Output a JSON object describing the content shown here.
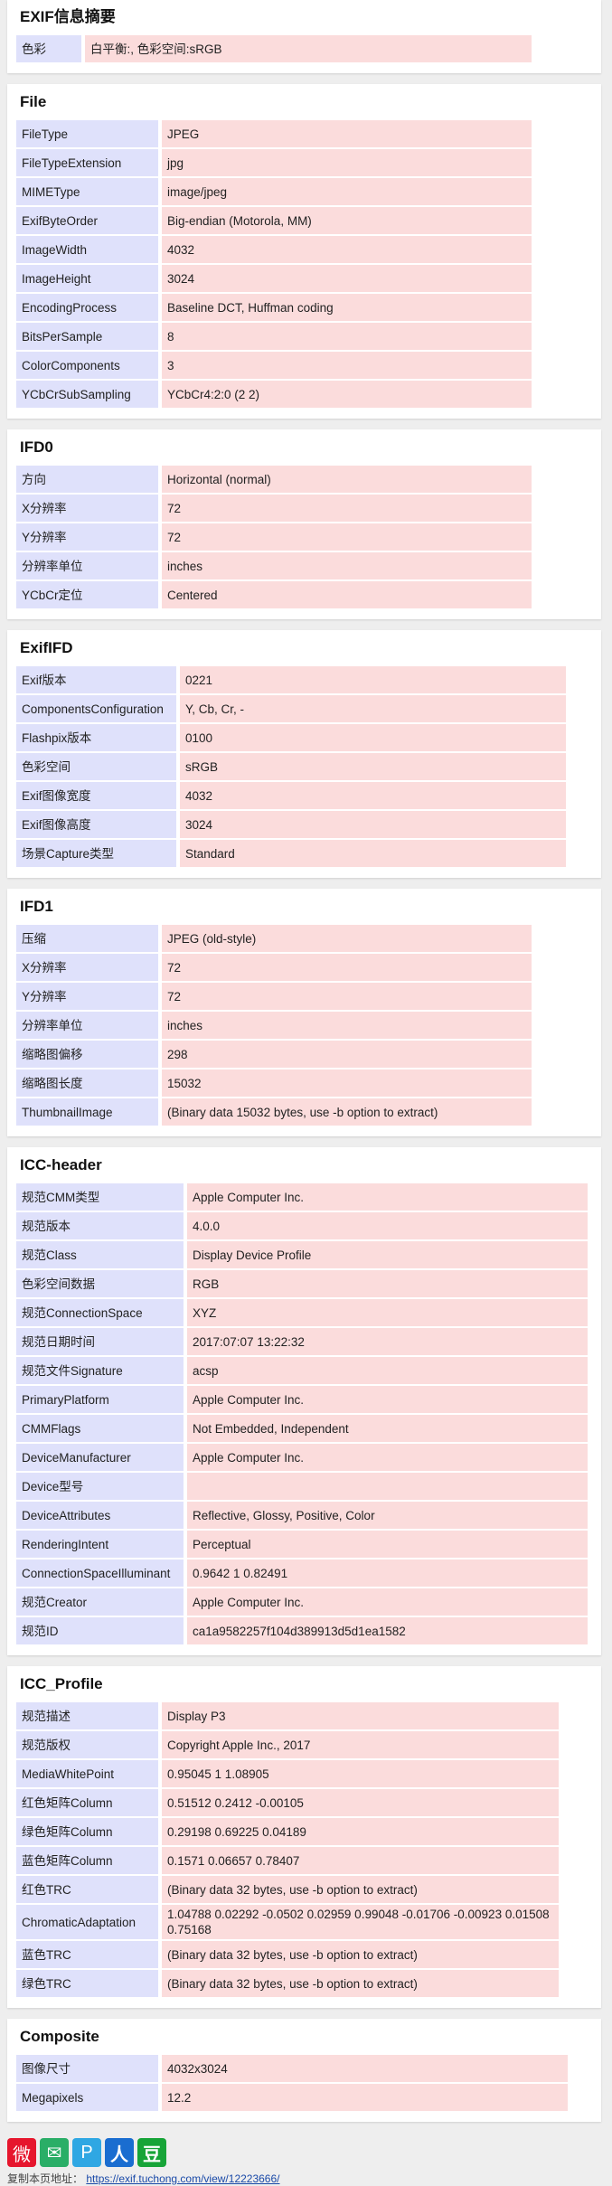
{
  "sections": [
    {
      "id": "summary",
      "title": "EXIF信息摘要",
      "key_width": 60,
      "table_width": 570,
      "rows": [
        {
          "k": "色彩",
          "v": "白平衡:, 色彩空间:sRGB"
        }
      ]
    },
    {
      "id": "file",
      "title": "File",
      "key_width": 145,
      "table_width": 570,
      "rows": [
        {
          "k": "FileType",
          "v": "JPEG"
        },
        {
          "k": "FileTypeExtension",
          "v": "jpg"
        },
        {
          "k": "MIMEType",
          "v": "image/jpeg"
        },
        {
          "k": "ExifByteOrder",
          "v": "Big-endian (Motorola, MM)"
        },
        {
          "k": "ImageWidth",
          "v": "4032"
        },
        {
          "k": "ImageHeight",
          "v": "3024"
        },
        {
          "k": "EncodingProcess",
          "v": "Baseline DCT, Huffman coding"
        },
        {
          "k": "BitsPerSample",
          "v": "8"
        },
        {
          "k": "ColorComponents",
          "v": "3"
        },
        {
          "k": "YCbCrSubSampling",
          "v": "YCbCr4:2:0 (2 2)"
        }
      ]
    },
    {
      "id": "ifd0",
      "title": "IFD0",
      "key_width": 145,
      "table_width": 570,
      "rows": [
        {
          "k": "方向",
          "v": "Horizontal (normal)"
        },
        {
          "k": "X分辨率",
          "v": "72"
        },
        {
          "k": "Y分辨率",
          "v": "72"
        },
        {
          "k": "分辨率单位",
          "v": "inches"
        },
        {
          "k": "YCbCr定位",
          "v": "Centered"
        }
      ]
    },
    {
      "id": "exififd",
      "title": "ExifIFD",
      "key_width": 165,
      "table_width": 608,
      "rows": [
        {
          "k": "Exif版本",
          "v": "0221"
        },
        {
          "k": "ComponentsConfiguration",
          "v": "Y, Cb, Cr, -"
        },
        {
          "k": "Flashpix版本",
          "v": "0100"
        },
        {
          "k": "色彩空间",
          "v": "sRGB"
        },
        {
          "k": "Exif图像宽度",
          "v": "4032"
        },
        {
          "k": "Exif图像高度",
          "v": "3024"
        },
        {
          "k": "场景Capture类型",
          "v": "Standard"
        }
      ]
    },
    {
      "id": "ifd1",
      "title": "IFD1",
      "key_width": 145,
      "table_width": 570,
      "rows": [
        {
          "k": "压缩",
          "v": "JPEG (old-style)"
        },
        {
          "k": "X分辨率",
          "v": "72"
        },
        {
          "k": "Y分辨率",
          "v": "72"
        },
        {
          "k": "分辨率单位",
          "v": "inches"
        },
        {
          "k": "缩略图偏移",
          "v": "298"
        },
        {
          "k": "缩略图长度",
          "v": "15032"
        },
        {
          "k": "ThumbnailImage",
          "v": "(Binary data 15032 bytes, use -b option to extract)"
        }
      ]
    },
    {
      "id": "icc-header",
      "title": "ICC-header",
      "key_width": 173,
      "table_width": 632,
      "rows": [
        {
          "k": "规范CMM类型",
          "v": "Apple Computer Inc."
        },
        {
          "k": "规范版本",
          "v": "4.0.0"
        },
        {
          "k": "规范Class",
          "v": "Display Device Profile"
        },
        {
          "k": "色彩空间数据",
          "v": "RGB"
        },
        {
          "k": "规范ConnectionSpace",
          "v": "XYZ"
        },
        {
          "k": "规范日期时间",
          "v": "2017:07:07 13:22:32"
        },
        {
          "k": "规范文件Signature",
          "v": "acsp"
        },
        {
          "k": "PrimaryPlatform",
          "v": "Apple Computer Inc."
        },
        {
          "k": "CMMFlags",
          "v": "Not Embedded, Independent"
        },
        {
          "k": "DeviceManufacturer",
          "v": "Apple Computer Inc."
        },
        {
          "k": "Device型号",
          "v": ""
        },
        {
          "k": "DeviceAttributes",
          "v": "Reflective, Glossy, Positive, Color"
        },
        {
          "k": "RenderingIntent",
          "v": "Perceptual"
        },
        {
          "k": "ConnectionSpaceIlluminant",
          "v": "0.9642 1 0.82491"
        },
        {
          "k": "规范Creator",
          "v": "Apple Computer Inc."
        },
        {
          "k": "规范ID",
          "v": "ca1a9582257f104d389913d5d1ea1582"
        }
      ]
    },
    {
      "id": "icc-profile",
      "title": "ICC_Profile",
      "key_width": 145,
      "table_width": 600,
      "rows": [
        {
          "k": "规范描述",
          "v": "Display P3"
        },
        {
          "k": "规范版权",
          "v": "Copyright Apple Inc., 2017"
        },
        {
          "k": "MediaWhitePoint",
          "v": "0.95045 1 1.08905"
        },
        {
          "k": "红色矩阵Column",
          "v": "0.51512 0.2412 -0.00105"
        },
        {
          "k": "绿色矩阵Column",
          "v": "0.29198 0.69225 0.04189"
        },
        {
          "k": "蓝色矩阵Column",
          "v": "0.1571 0.06657 0.78407"
        },
        {
          "k": "红色TRC",
          "v": "(Binary data 32 bytes, use -b option to extract)"
        },
        {
          "k": "ChromaticAdaptation",
          "v": "1.04788 0.02292 -0.0502 0.02959 0.99048 -0.01706 -0.00923 0.01508 0.75168"
        },
        {
          "k": "蓝色TRC",
          "v": "(Binary data 32 bytes, use -b option to extract)"
        },
        {
          "k": "绿色TRC",
          "v": "(Binary data 32 bytes, use -b option to extract)"
        }
      ]
    },
    {
      "id": "composite",
      "title": "Composite",
      "key_width": 145,
      "table_width": 610,
      "rows": [
        {
          "k": "图像尺寸",
          "v": "4032x3024"
        },
        {
          "k": "Megapixels",
          "v": "12.2"
        }
      ]
    }
  ],
  "share_icons": [
    {
      "name": "weibo-share-icon",
      "glyph": "微",
      "cls": "ic-weibo"
    },
    {
      "name": "wechat-share-icon",
      "glyph": "✉",
      "cls": "ic-wechat"
    },
    {
      "name": "pengyou-share-icon",
      "glyph": "P",
      "cls": "ic-p"
    },
    {
      "name": "renren-share-icon",
      "glyph": "人",
      "cls": "ic-people"
    },
    {
      "name": "douban-share-icon",
      "glyph": "豆",
      "cls": "ic-douban"
    }
  ],
  "footer": {
    "copy_label": "复制本页地址：",
    "copy_url": "https://exif.tuchong.com/view/12223666/"
  }
}
